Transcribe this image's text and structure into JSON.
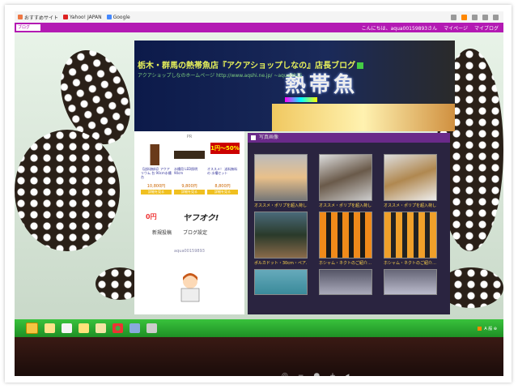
{
  "browser": {
    "bookmarks": [
      "おすすめサイト",
      "Yahoo! JAPAN",
      "Google"
    ],
    "search_placeholder": "ブログ",
    "greeting": "こんにちは、aqua00159893さん",
    "menu": [
      "マイページ",
      "マイブログ"
    ]
  },
  "blog": {
    "title": "栃木・群馬の熱帯魚店『アクアショップしなの』店長ブログ",
    "subtitle": "アクアショップしなのホームページ http://www.aqshi.ne.jp/ ~aqua0015",
    "sign_text": "熱帯魚"
  },
  "sidebar": {
    "header": "PR",
    "products": [
      {
        "name": "【送料無料】アクアリウム 台 90cm水槽台",
        "price": "10,800円",
        "button": "詳細を見る"
      },
      {
        "name": "水槽用 LED照明 90cm",
        "price": "9,800円",
        "button": "詳細を見る"
      },
      {
        "name": "オススメ！ 送料無料の 水槽セット",
        "price": "8,800円",
        "button": "詳細を見る"
      }
    ],
    "banner": "1円〜50%",
    "point": "0円",
    "yafuoku": "ヤフオク!",
    "links": [
      "新規投稿",
      "ブログ設定"
    ],
    "user_id": "aqua00159893"
  },
  "gallery": {
    "header": "写真画像",
    "captions": [
      "オススメ・ポリプを超入荷しま…",
      "オススメ・ポリプを超入荷しま…",
      "オススメ・ポリプを超入荷しま…",
      "ポルカドット・30cm・ペア…",
      "ホシャム・ネクトのご紹介…",
      "ホシャム・ネクトのご紹介…",
      "",
      "",
      ""
    ]
  },
  "taskbar": {
    "apps": [
      "app-1",
      "app-2",
      "app-3",
      "app-4",
      "app-5",
      "app-6",
      "app-7",
      "app-8"
    ],
    "tray": "A 般 ⊕"
  },
  "colors": {
    "accent": "#b31ab3",
    "taskbar": "#2aa830",
    "title": "#e6f05a",
    "caption": "#ffd54a"
  }
}
